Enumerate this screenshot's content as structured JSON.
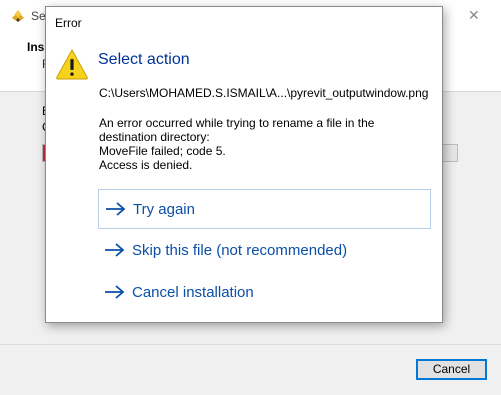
{
  "background_window": {
    "title": "Se",
    "heading": "Ins",
    "subheading": "F",
    "status_line_a": "E",
    "status_line_b": "C",
    "progress_fraction": 0.01,
    "cancel_label": "Cancel"
  },
  "dialog": {
    "title": "Error",
    "instruction": "Select action",
    "path": "C:\\Users\\MOHAMED.S.ISMAIL\\A...\\pyrevit_outputwindow.png",
    "message_lines": [
      "An error occurred while trying to rename a file in the",
      "destination directory:",
      "MoveFile failed; code 5.",
      "Access is denied."
    ],
    "commands": [
      {
        "label": "Try again"
      },
      {
        "label": "Skip this file (not recommended)"
      },
      {
        "label": "Cancel installation"
      }
    ]
  },
  "colors": {
    "instruction": "#003399",
    "command_link": "#0a4fa8",
    "progress_fill": "#c8303a",
    "focus_border": "#0078d7"
  },
  "icons": {
    "app": "installer-app-icon",
    "warning": "warning-triangle-icon",
    "command_arrow": "right-arrow-icon"
  }
}
